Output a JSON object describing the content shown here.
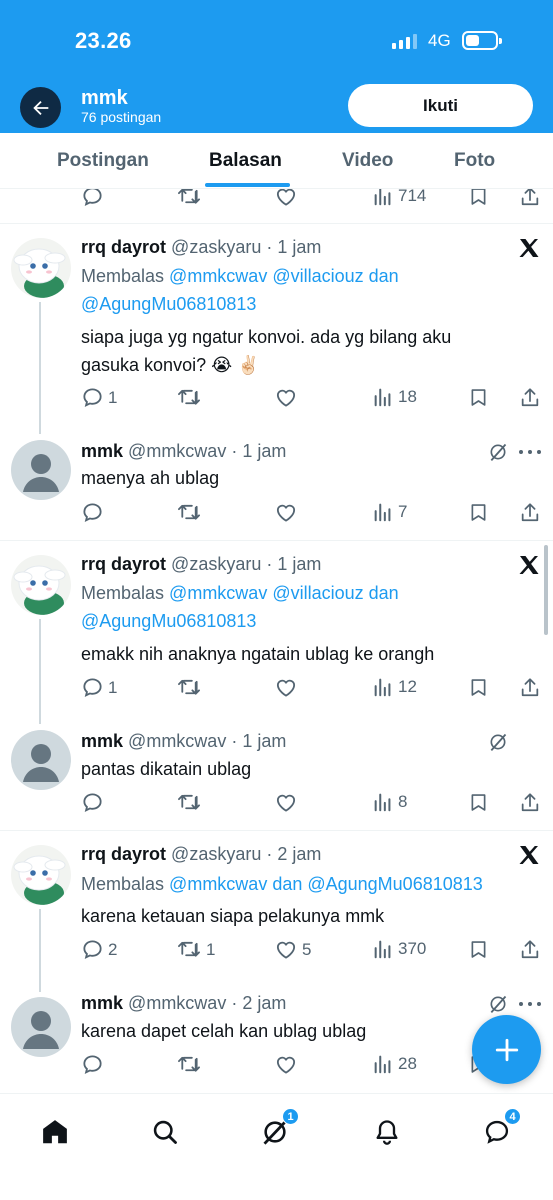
{
  "status_bar": {
    "time": "23.26",
    "network": "4G"
  },
  "header": {
    "profile_name": "mmk",
    "post_count": "76 postingan",
    "follow_label": "Ikuti"
  },
  "tabs": [
    {
      "label": "Postingan"
    },
    {
      "label": "Balasan",
      "active": true
    },
    {
      "label": "Video"
    },
    {
      "label": "Foto"
    }
  ],
  "partial_post": {
    "views": "714"
  },
  "tweets": [
    {
      "name": "rrq dayrot",
      "handle": "@zaskyaru",
      "time": "1 jam",
      "reply_prefix": "Membalas",
      "reply_mentions": "@mmkcwav @villaciouz dan @AgungMu06810813",
      "text": "siapa juga yg ngatur konvoi. ada yg bilang aku gasuka konvoi? 😭 ✌🏻",
      "replies": "1",
      "retweets": "",
      "likes": "",
      "views": "18"
    },
    {
      "name": "mmk",
      "handle": "@mmkcwav",
      "time": "1 jam",
      "text": "maenya ah ublag",
      "replies": "",
      "retweets": "",
      "likes": "",
      "views": "7"
    },
    {
      "name": "rrq dayrot",
      "handle": "@zaskyaru",
      "time": "1 jam",
      "reply_prefix": "Membalas",
      "reply_mentions": "@mmkcwav @villaciouz dan @AgungMu06810813",
      "text": "emakk nih anaknya ngatain ublag ke orangh",
      "replies": "1",
      "retweets": "",
      "likes": "",
      "views": "12"
    },
    {
      "name": "mmk",
      "handle": "@mmkcwav",
      "time": "1 jam",
      "text": "pantas dikatain ublag",
      "replies": "",
      "retweets": "",
      "likes": "",
      "views": "8"
    },
    {
      "name": "rrq dayrot",
      "handle": "@zaskyaru",
      "time": "2 jam",
      "reply_prefix": "Membalas",
      "reply_mentions": "@mmkcwav dan @AgungMu06810813",
      "text": "karena ketauan siapa pelakunya mmk",
      "replies": "2",
      "retweets": "1",
      "likes": "5",
      "views": "370"
    },
    {
      "name": "mmk",
      "handle": "@mmkcwav",
      "time": "2 jam",
      "text": "karena dapet celah kan ublag ublag",
      "replies": "",
      "retweets": "",
      "likes": "",
      "views": "28"
    }
  ],
  "bottom_nav": {
    "items": [
      {
        "icon": "home-icon"
      },
      {
        "icon": "search-icon"
      },
      {
        "icon": "grok-icon",
        "badge": "1"
      },
      {
        "icon": "bell-icon"
      },
      {
        "icon": "messages-icon",
        "badge": "4"
      }
    ]
  },
  "colors": {
    "accent": "#1d9bf0",
    "text": "#0f1419",
    "muted": "#536471"
  }
}
